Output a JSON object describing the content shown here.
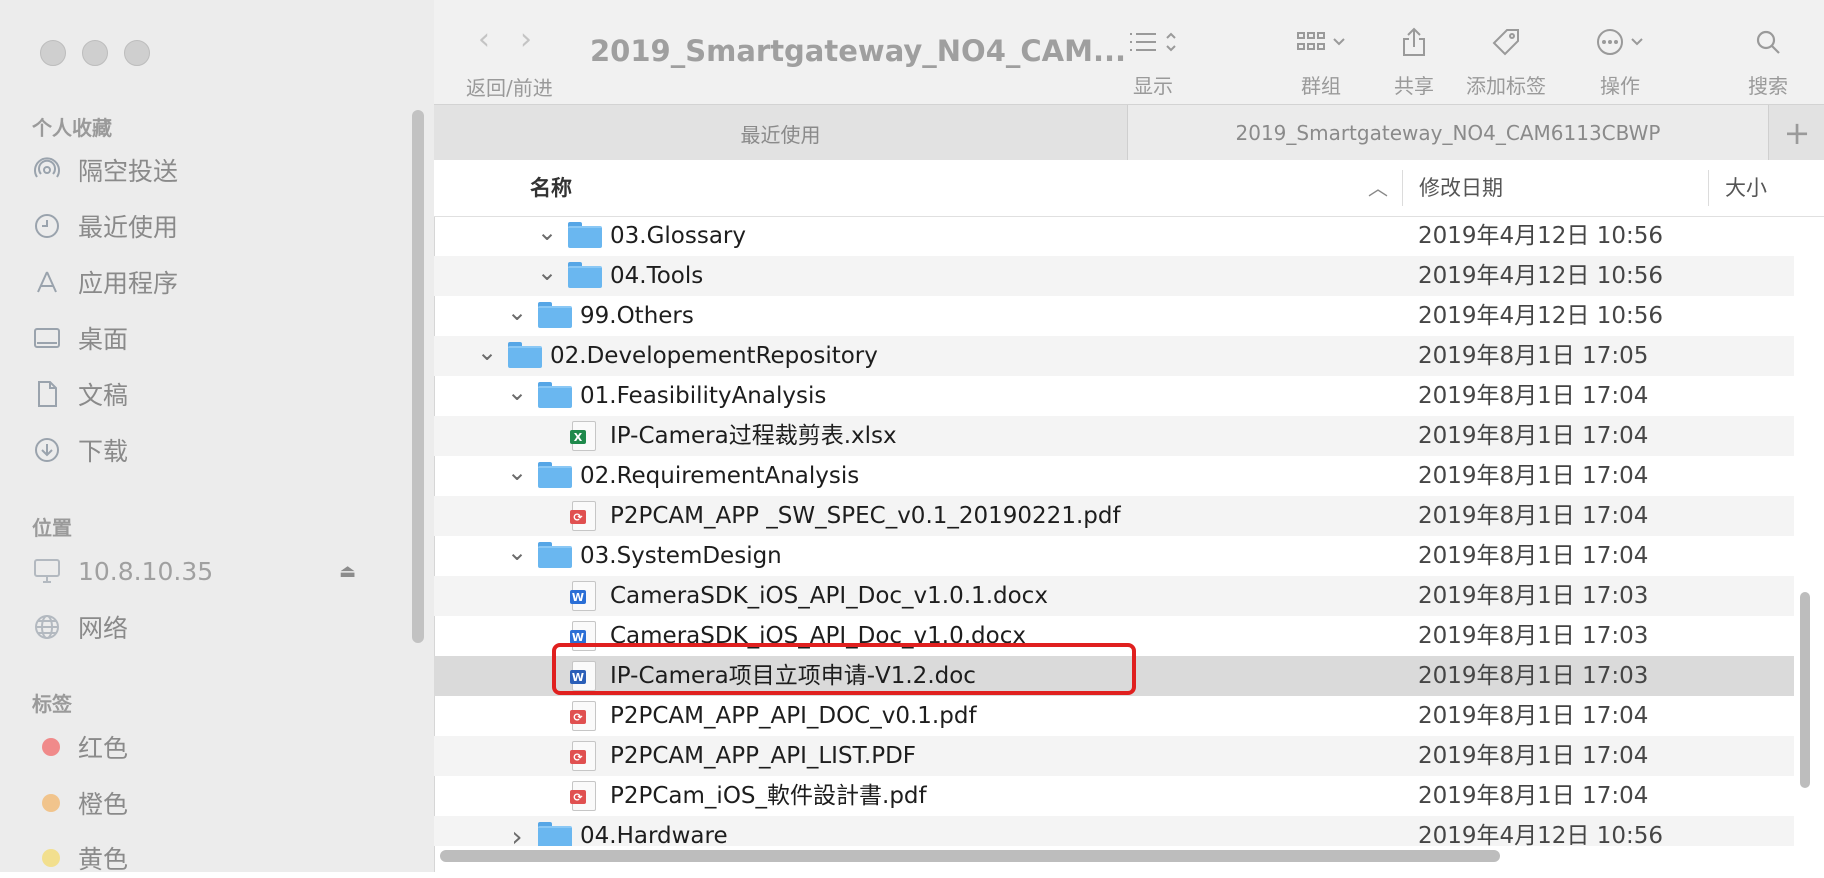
{
  "sidebar": {
    "favorites_title": "个人收藏",
    "favorites": [
      {
        "label": "隔空投送",
        "icon": "airdrop-icon"
      },
      {
        "label": "最近使用",
        "icon": "clock-icon"
      },
      {
        "label": "应用程序",
        "icon": "applications-icon"
      },
      {
        "label": "桌面",
        "icon": "desktop-icon"
      },
      {
        "label": "文稿",
        "icon": "document-icon"
      },
      {
        "label": "下载",
        "icon": "download-icon"
      }
    ],
    "locations_title": "位置",
    "locations": [
      {
        "label": "10.8.10.35",
        "icon": "monitor-icon"
      },
      {
        "label": "网络",
        "icon": "globe-icon"
      }
    ],
    "tags_title": "标签",
    "tags": [
      {
        "label": "红色",
        "color": "#f08080"
      },
      {
        "label": "橙色",
        "color": "#f3c58a"
      },
      {
        "label": "黄色",
        "color": "#f2e08c"
      }
    ]
  },
  "toolbar": {
    "title": "2019_Smartgateway_NO4_CAM...",
    "back_forward_label": "返回/前进",
    "view_label": "显示",
    "group_label": "群组",
    "share_label": "共享",
    "tags_label": "添加标签",
    "action_label": "操作",
    "search_label": "搜索"
  },
  "tabs": {
    "tab1": "最近使用",
    "tab2": "2019_Smartgateway_NO4_CAM6113CBWP",
    "add": "+"
  },
  "columns": {
    "name": "名称",
    "modified": "修改日期",
    "size": "大小"
  },
  "files": [
    {
      "name": "03.Glossary",
      "date": "2019年4月12日 10:56",
      "type": "folder",
      "level": 3,
      "expanded": true
    },
    {
      "name": "04.Tools",
      "date": "2019年4月12日 10:56",
      "type": "folder",
      "level": 3,
      "expanded": true
    },
    {
      "name": "99.Others",
      "date": "2019年4月12日 10:56",
      "type": "folder",
      "level": 2,
      "expanded": true
    },
    {
      "name": "02.DevelopementRepository",
      "date": "2019年8月1日 17:05",
      "type": "folder",
      "level": 1,
      "expanded": true
    },
    {
      "name": "01.FeasibilityAnalysis",
      "date": "2019年8月1日 17:04",
      "type": "folder",
      "level": 2,
      "expanded": true
    },
    {
      "name": "IP-Camera过程裁剪表.xlsx",
      "date": "2019年8月1日 17:04",
      "type": "xlsx",
      "level": 3
    },
    {
      "name": "02.RequirementAnalysis",
      "date": "2019年8月1日 17:04",
      "type": "folder",
      "level": 2,
      "expanded": true
    },
    {
      "name": "P2PCAM_APP _SW_SPEC_v0.1_20190221.pdf",
      "date": "2019年8月1日 17:04",
      "type": "pdf",
      "level": 3
    },
    {
      "name": "03.SystemDesign",
      "date": "2019年8月1日 17:04",
      "type": "folder",
      "level": 2,
      "expanded": true
    },
    {
      "name": "CameraSDK_iOS_API_Doc_v1.0.1.docx",
      "date": "2019年8月1日 17:03",
      "type": "docx",
      "level": 3
    },
    {
      "name": "CameraSDK_iOS_API_Doc_v1.0.docx",
      "date": "2019年8月1日 17:03",
      "type": "docx",
      "level": 3
    },
    {
      "name": "IP-Camera项目立项申请-V1.2.doc",
      "date": "2019年8月1日 17:03",
      "type": "doc",
      "level": 3,
      "selected": true
    },
    {
      "name": "P2PCAM_APP_API_DOC_v0.1.pdf",
      "date": "2019年8月1日 17:04",
      "type": "pdf",
      "level": 3
    },
    {
      "name": "P2PCAM_APP_API_LIST.PDF",
      "date": "2019年8月1日 17:04",
      "type": "pdf",
      "level": 3
    },
    {
      "name": "P2PCam_iOS_軟件設計書.pdf",
      "date": "2019年8月1日 17:04",
      "type": "pdf",
      "level": 3
    },
    {
      "name": "04.Hardware",
      "date": "2019年4月12日 10:56",
      "type": "folder",
      "level": 2,
      "expanded": false
    }
  ]
}
